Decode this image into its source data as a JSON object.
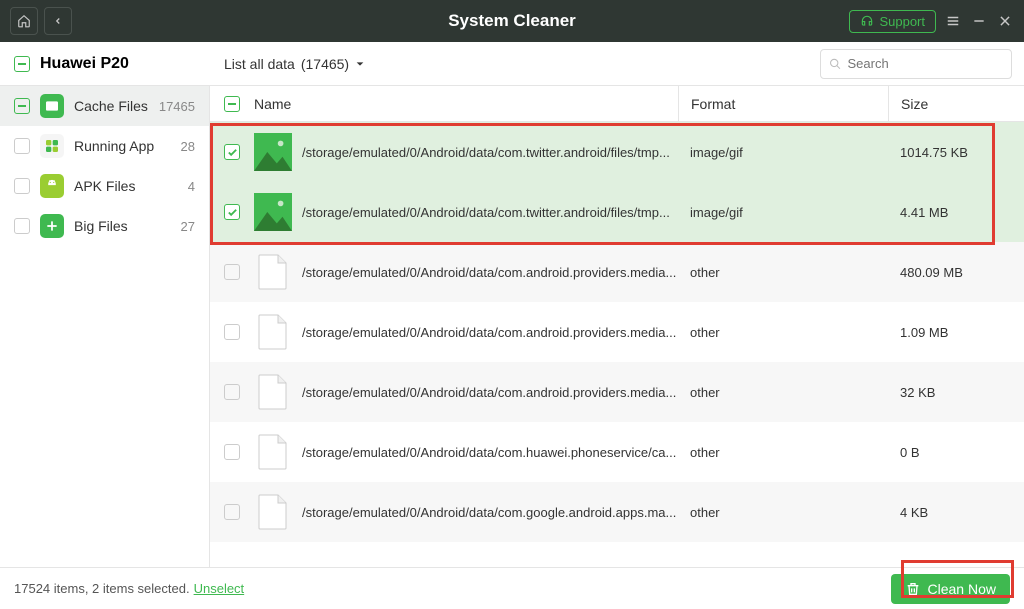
{
  "app": {
    "title": "System Cleaner",
    "support_label": "Support"
  },
  "device": {
    "name": "Huawei P20"
  },
  "filter": {
    "prefix": "List all data",
    "count": "(17465)"
  },
  "search": {
    "placeholder": "Search"
  },
  "sidebar": {
    "items": [
      {
        "label": "Cache Files",
        "count": "17465"
      },
      {
        "label": "Running App",
        "count": "28"
      },
      {
        "label": "APK Files",
        "count": "4"
      },
      {
        "label": "Big Files",
        "count": "27"
      }
    ]
  },
  "table": {
    "headers": {
      "name": "Name",
      "format": "Format",
      "size": "Size"
    },
    "rows": [
      {
        "path": "/storage/emulated/0/Android/data/com.twitter.android/files/tmp...",
        "format": "image/gif",
        "size": "1014.75 KB",
        "checked": true,
        "thumb": "image"
      },
      {
        "path": "/storage/emulated/0/Android/data/com.twitter.android/files/tmp...",
        "format": "image/gif",
        "size": "4.41 MB",
        "checked": true,
        "thumb": "image"
      },
      {
        "path": "/storage/emulated/0/Android/data/com.android.providers.media...",
        "format": "other",
        "size": "480.09 MB",
        "checked": false,
        "thumb": "doc"
      },
      {
        "path": "/storage/emulated/0/Android/data/com.android.providers.media...",
        "format": "other",
        "size": "1.09 MB",
        "checked": false,
        "thumb": "doc"
      },
      {
        "path": "/storage/emulated/0/Android/data/com.android.providers.media...",
        "format": "other",
        "size": "32 KB",
        "checked": false,
        "thumb": "doc"
      },
      {
        "path": "/storage/emulated/0/Android/data/com.huawei.phoneservice/ca...",
        "format": "other",
        "size": "0 B",
        "checked": false,
        "thumb": "doc"
      },
      {
        "path": "/storage/emulated/0/Android/data/com.google.android.apps.ma...",
        "format": "other",
        "size": "4 KB",
        "checked": false,
        "thumb": "doc"
      }
    ]
  },
  "footer": {
    "status": "17524 items, 2 items selected.",
    "unselect": "Unselect",
    "clean": "Clean Now"
  }
}
